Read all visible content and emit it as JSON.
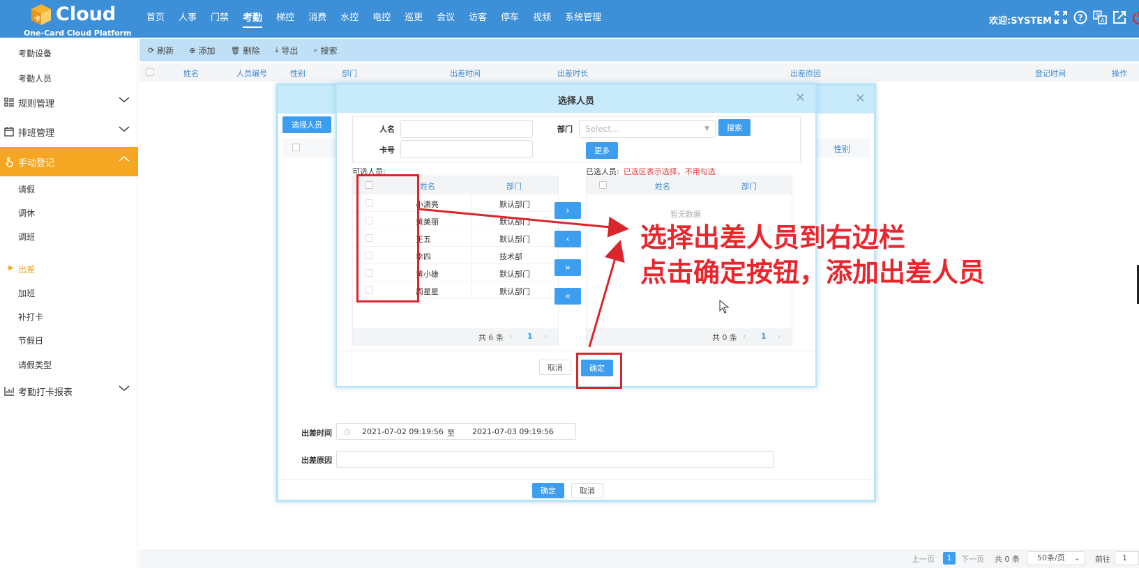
{
  "header": {
    "logo_text": "Cloud",
    "logo_sub": "One-Card Cloud Platform",
    "nav": [
      "首页",
      "人事",
      "门禁",
      "考勤",
      "梯控",
      "消费",
      "水控",
      "电控",
      "巡更",
      "会议",
      "访客",
      "停车",
      "视频",
      "系统管理"
    ],
    "welcome": "欢迎:SYSTEM"
  },
  "sidebar": {
    "top_items": [
      "考勤设备",
      "考勤人员"
    ],
    "groups": [
      "规则管理",
      "排班管理",
      "手动登记",
      "考勤打卡报表"
    ],
    "sub_items": [
      "请假",
      "调休",
      "调班",
      "出差",
      "加班",
      "补打卡",
      "节假日",
      "请假类型"
    ]
  },
  "toolbar": {
    "buttons": [
      "刷新",
      "添加",
      "删除",
      "导出",
      "搜索"
    ]
  },
  "main_table": {
    "columns": [
      "姓名",
      "人员编号",
      "性别",
      "部门",
      "出差时间",
      "出差时长",
      "出差原因",
      "登记时间",
      "操作"
    ]
  },
  "pager": {
    "prev": "上一页",
    "page": "1",
    "next": "下一页",
    "total": "共 0 条",
    "size": "50条/页",
    "goto": "前往",
    "goto_value": "1"
  },
  "outer_dialog": {
    "select_button": "选择人员",
    "column_gender": "性别",
    "time_label": "出差时间",
    "start_time": "2021-07-02 09:19:56",
    "to": "至",
    "end_time": "2021-07-03 09:19:56",
    "reason_label": "出差原因",
    "ok": "确定",
    "cancel": "取消"
  },
  "inner_dialog": {
    "title": "选择人员",
    "name_label": "人名",
    "card_label": "卡号",
    "dept_label": "部门",
    "dept_placeholder": "Select...",
    "search_button": "搜索",
    "more_button": "更多",
    "left_title": "可选人员:",
    "right_title": "已选人员:",
    "right_hint": "已选区表示选择，不用勾选",
    "col_name": "姓名",
    "col_dept": "部门",
    "rows": [
      {
        "name": "小潇亮",
        "dept": "默认部门"
      },
      {
        "name": "黄美丽",
        "dept": "默认部门"
      },
      {
        "name": "王五",
        "dept": "默认部门"
      },
      {
        "name": "李四",
        "dept": "技术部"
      },
      {
        "name": "黄小雄",
        "dept": "默认部门"
      },
      {
        "name": "周星星",
        "dept": "默认部门"
      }
    ],
    "left_total": "共 6 条",
    "right_total": "共 0 条",
    "page": "1",
    "empty_text": "暂无数据",
    "arrows": [
      "›",
      "‹",
      "»",
      "«"
    ],
    "cancel": "取消",
    "ok": "确定"
  },
  "annotation": {
    "line1": "选择出差人员到右边栏",
    "line2": "点击确定按钮，添加出差人员",
    "color": "#e8262c"
  }
}
